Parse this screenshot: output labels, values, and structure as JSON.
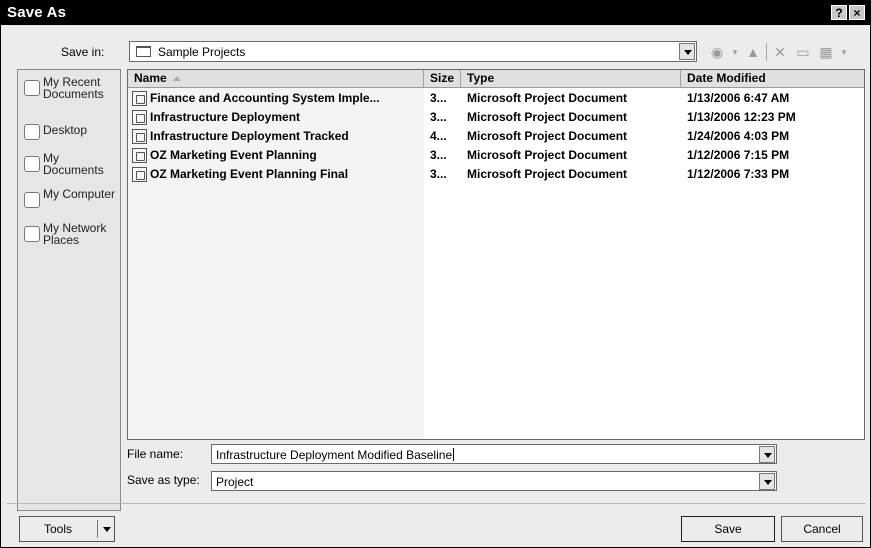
{
  "window": {
    "title": "Save As",
    "help_button": "?",
    "close_button": "×"
  },
  "save_in": {
    "label": "Save in:",
    "value": "Sample Projects"
  },
  "toolbar": {
    "icons": [
      "back-icon",
      "up-folder-icon",
      "delete-icon",
      "new-folder-icon",
      "views-icon"
    ]
  },
  "places": [
    {
      "label": "My Recent Documents",
      "icon": "recent-documents-icon"
    },
    {
      "label": "Desktop",
      "icon": "desktop-icon"
    },
    {
      "label": "My Documents",
      "icon": "my-documents-icon"
    },
    {
      "label": "My Computer",
      "icon": "my-computer-icon"
    },
    {
      "label": "My Network Places",
      "icon": "network-places-icon"
    }
  ],
  "columns": {
    "name": "Name",
    "size": "Size",
    "type": "Type",
    "date": "Date Modified"
  },
  "files": [
    {
      "name": "Finance and Accounting System Imple...",
      "size": "3...",
      "type": "Microsoft Project Document",
      "date": "1/13/2006 6:47 AM"
    },
    {
      "name": "Infrastructure Deployment",
      "size": "3...",
      "type": "Microsoft Project Document",
      "date": "1/13/2006 12:23 PM"
    },
    {
      "name": "Infrastructure Deployment Tracked",
      "size": "4...",
      "type": "Microsoft Project Document",
      "date": "1/24/2006 4:03 PM"
    },
    {
      "name": "OZ Marketing Event Planning",
      "size": "3...",
      "type": "Microsoft Project Document",
      "date": "1/12/2006 7:15 PM"
    },
    {
      "name": "OZ Marketing Event Planning Final",
      "size": "3...",
      "type": "Microsoft Project Document",
      "date": "1/12/2006 7:33 PM"
    }
  ],
  "file_name": {
    "label": "File name:",
    "value": "Infrastructure Deployment Modified Baseline"
  },
  "save_as_type": {
    "label": "Save as type:",
    "value": "Project"
  },
  "buttons": {
    "tools": "Tools",
    "save": "Save",
    "cancel": "Cancel"
  }
}
